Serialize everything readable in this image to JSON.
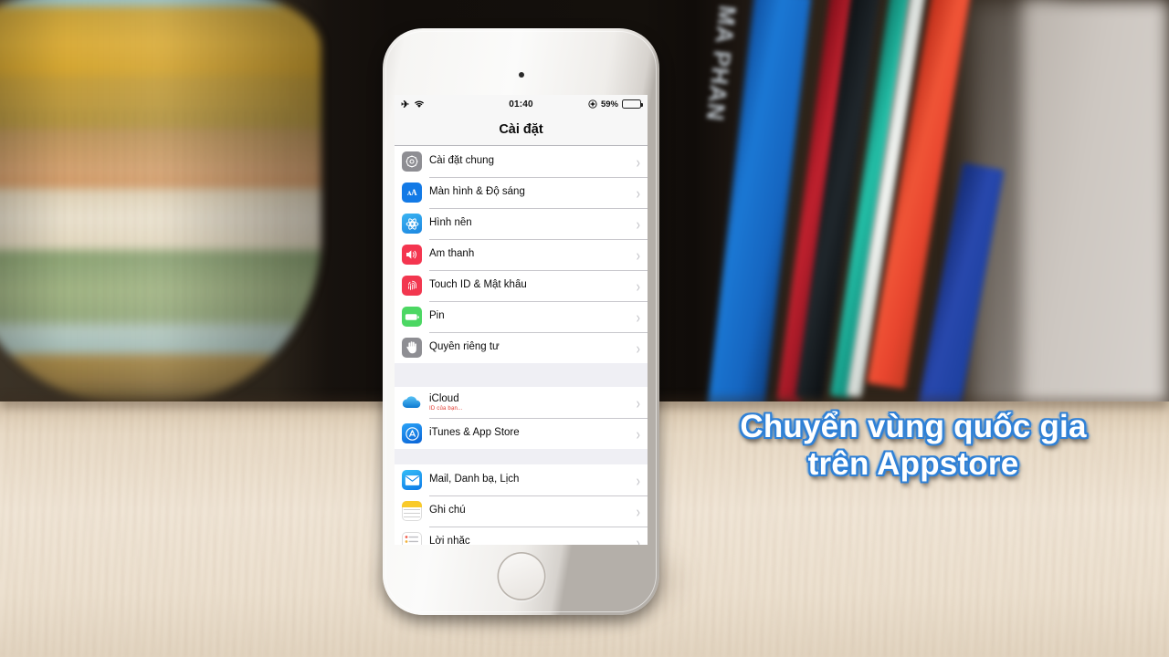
{
  "scene": {
    "description": "iPhone on wooden table showing iOS Settings in Vietnamese",
    "background_objects": [
      "striped-ceramic-vase",
      "stacked-books",
      "wooden-table"
    ],
    "colors": {
      "table": "#efe4d4",
      "dark_shelf": "#15110d",
      "overlay_text": "#ffffff",
      "overlay_outline": "#2f80d6",
      "ios_list_bg": "#efeff4",
      "ios_row_bg": "#ffffff",
      "ios_separator": "#c8c7cc",
      "ios_chevron": "#c2c2c7",
      "icloud_warning": "#e0362c"
    },
    "books": [
      {
        "color": "#1565c0",
        "title": "MA PHAN"
      },
      {
        "color": "#a01220",
        "title": ""
      },
      {
        "color": "#14191c",
        "title": ""
      },
      {
        "color": "#18a08d",
        "title": ""
      },
      {
        "color": "#e8452e",
        "title": ""
      },
      {
        "color": "#1b3f9e",
        "title": ""
      }
    ]
  },
  "phone": {
    "hardware": {
      "speaker": "earpiece-speaker",
      "camera": "front-camera",
      "sensor": "proximity-sensor",
      "home_button": "home-button"
    },
    "statusbar": {
      "airplane_icon": "airplane-icon",
      "wifi_icon": "wifi-icon",
      "time": "01:40",
      "location_icon": "location-icon",
      "battery_percent": "59%",
      "battery_level": 59
    },
    "navbar": {
      "title": "Cài đặt"
    },
    "settings_groups": [
      {
        "group_id": "system",
        "rows": [
          {
            "label": "Cài đặt chung",
            "icon": "gear-icon",
            "icon_class": "gear",
            "chevron": "›",
            "sub": ""
          },
          {
            "label": "Màn hình & Độ sáng",
            "icon": "display-brightness-icon",
            "icon_class": "aa",
            "chevron": "›",
            "sub": ""
          },
          {
            "label": "Hình nền",
            "icon": "wallpaper-icon",
            "icon_class": "wall",
            "chevron": "›",
            "sub": ""
          },
          {
            "label": "Âm thanh",
            "icon": "sound-icon",
            "icon_class": "snd",
            "chevron": "›",
            "sub": ""
          },
          {
            "label": "Touch ID & Mật khẩu",
            "icon": "touch-id-icon",
            "icon_class": "tid",
            "chevron": "›",
            "sub": ""
          },
          {
            "label": "Pin",
            "icon": "battery-icon",
            "icon_class": "pin",
            "chevron": "›",
            "sub": ""
          },
          {
            "label": "Quyền riêng tư",
            "icon": "privacy-hand-icon",
            "icon_class": "priv",
            "chevron": "›",
            "sub": ""
          }
        ]
      },
      {
        "group_id": "accounts",
        "rows": [
          {
            "label": "iCloud",
            "icon": "icloud-icon",
            "icon_class": "icloud-ic",
            "chevron": "›",
            "sub": "ID của bạn..."
          },
          {
            "label": "iTunes & App Store",
            "icon": "app-store-icon",
            "icon_class": "itunes",
            "chevron": "›",
            "sub": ""
          }
        ]
      },
      {
        "group_id": "apps",
        "rows": [
          {
            "label": "Mail, Danh bạ, Lịch",
            "icon": "mail-icon",
            "icon_class": "mail",
            "chevron": "›",
            "sub": ""
          },
          {
            "label": "Ghi chú",
            "icon": "notes-icon",
            "icon_class": "notes",
            "chevron": "›",
            "sub": ""
          },
          {
            "label": "Lời nhắc",
            "icon": "reminders-icon",
            "icon_class": "remind",
            "chevron": "›",
            "sub": ""
          }
        ]
      }
    ]
  },
  "overlay": {
    "line1": "Chuyển vùng quốc gia",
    "line2": "trên Appstore"
  }
}
